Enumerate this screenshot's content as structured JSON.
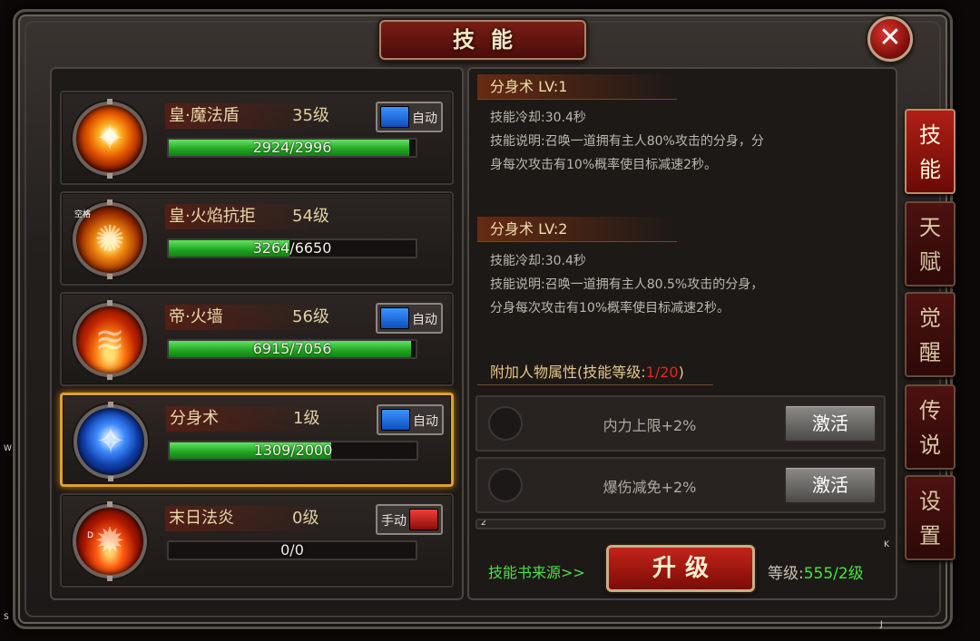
{
  "window": {
    "title": "技能",
    "close_label": "✕"
  },
  "skills": [
    {
      "name": "皇·魔法盾",
      "level": "35级",
      "progress": "2924/2996",
      "fill": 0.976,
      "toggle": "自动",
      "mode": "on",
      "icon": "fire-shield-icon",
      "glyph": "✦"
    },
    {
      "name": "皇·火焰抗拒",
      "level": "54级",
      "progress": "3264/6650",
      "fill": 0.49,
      "toggle": "",
      "mode": "none",
      "icon": "flame-ring-icon",
      "glyph": "✺",
      "tag": "空格"
    },
    {
      "name": "帝·火墙",
      "level": "56级",
      "progress": "6915/7056",
      "fill": 0.98,
      "toggle": "自动",
      "mode": "on",
      "icon": "fire-wall-icon",
      "glyph": "≋"
    },
    {
      "name": "分身术",
      "level": "1级",
      "progress": "1309/2000",
      "fill": 0.655,
      "toggle": "自动",
      "mode": "on",
      "icon": "clone-icon",
      "glyph": "✧"
    },
    {
      "name": "末日法炎",
      "level": "0级",
      "progress": "0/0",
      "fill": 0,
      "toggle": "手动",
      "mode": "off",
      "icon": "doom-flame-icon",
      "glyph": "✹",
      "tag": "D"
    }
  ],
  "detail": {
    "lv1": {
      "heading": "分身术   LV:1",
      "cooldown": "技能冷却:30.4秒",
      "desc_line1": "技能说明:召唤一道拥有主人80%攻击的分身，分",
      "desc_line2": "身每次攻击有10%概率使目标减速2秒。"
    },
    "lv2": {
      "heading": "分身术   LV:2",
      "cooldown": "技能冷却:30.4秒",
      "desc_line1": "技能说明:召唤一道拥有主人80.5%攻击的分身，",
      "desc_line2": "分身每次攻击有10%概率使目标减速2秒。"
    },
    "attr_heading": "附加人物属性(技能等级:",
    "attr_level": "1/20",
    "attr_close": ")",
    "attributes": [
      {
        "text": "内力上限+2%",
        "button": "激活"
      },
      {
        "text": "爆伤减免+2%",
        "button": "激活"
      }
    ]
  },
  "footer": {
    "book_source": "技能书来源>>",
    "upgrade": "升级",
    "grade_label": "等级:",
    "grade_value": "555/2级"
  },
  "side_tabs": [
    {
      "label": "技\n能",
      "active": true
    },
    {
      "label": "天\n赋",
      "active": false
    },
    {
      "label": "觉\n醒",
      "active": false
    },
    {
      "label": "传\n说",
      "active": false
    },
    {
      "label": "设\n置",
      "active": false
    }
  ],
  "edge_marks": {
    "w": "W",
    "s": "S",
    "k": "K",
    "j": "J",
    "two": "2"
  }
}
